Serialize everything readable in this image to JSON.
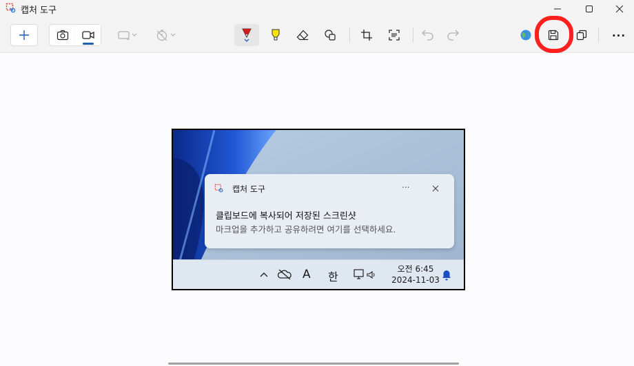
{
  "window": {
    "title": "캡처 도구",
    "controls": [
      "minimize-icon",
      "maximize-icon",
      "close-icon"
    ]
  },
  "toolbar": {
    "new_button": "plus-icon",
    "mode_buttons": [
      "camera-icon",
      "video-icon"
    ],
    "active_mode": "video",
    "shape_dropdown": "rectangle-snip-icon",
    "delay_dropdown": "timer-off-icon",
    "tools": [
      "ballpoint-pen-icon",
      "highlighter-icon",
      "eraser-icon",
      "shapes-icon",
      "crop-icon",
      "text-actions-icon",
      "undo-icon",
      "redo-icon"
    ],
    "right_actions": [
      "share-icon",
      "save-icon",
      "copy-icon",
      "more-icon"
    ],
    "highlighted_action": "save-icon",
    "highlight_color": "#ff1f1f",
    "more_label": "..."
  },
  "screenshot": {
    "notification": {
      "app_name": "캡처 도구",
      "more_label": "...",
      "headline": "클립보드에 복사되어 저장된 스크린샷",
      "body": "마크업을 추가하고 공유하려면 여기를 선택하세요."
    },
    "taskbar": {
      "ime_letter": "A",
      "ime_lang": "한",
      "time": "오전 6:45",
      "date": "2024-11-03"
    }
  }
}
